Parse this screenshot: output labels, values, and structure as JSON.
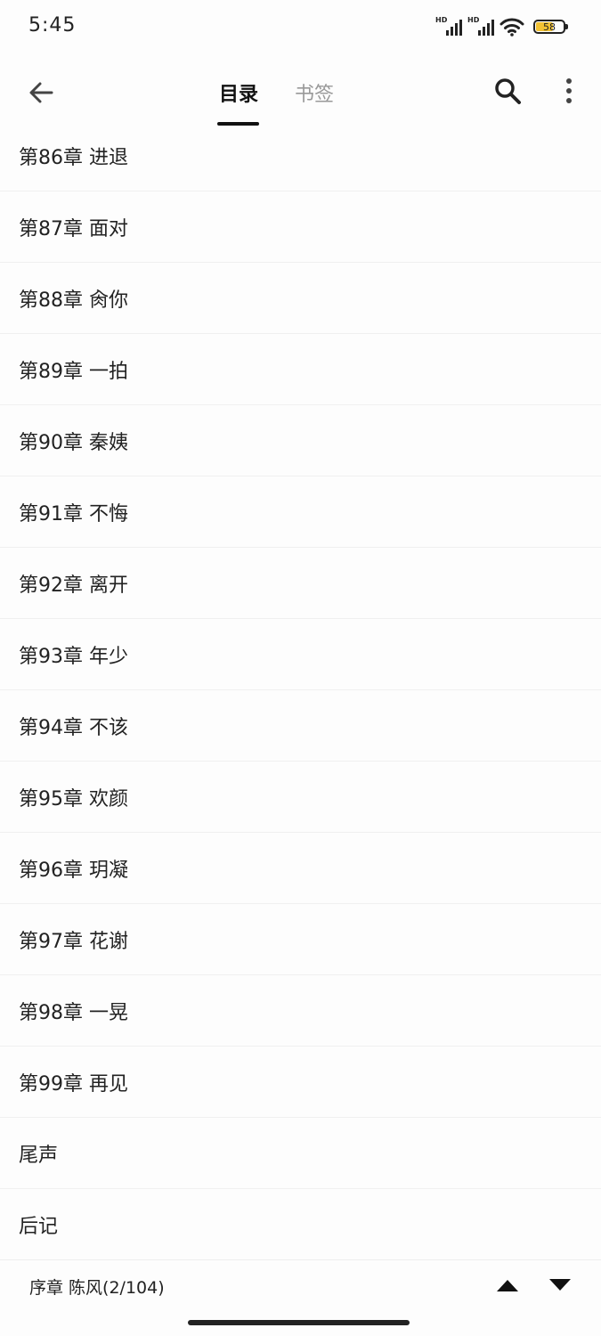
{
  "status_bar": {
    "time": "5:45",
    "signal_label_1": "HD",
    "signal_label_2": "HD",
    "battery_level": "58"
  },
  "header": {
    "tabs": [
      {
        "label": "目录",
        "active": true
      },
      {
        "label": "书签",
        "active": false
      }
    ],
    "icons": {
      "back": "arrow-left-icon",
      "search": "search-icon",
      "more": "more-vertical-icon"
    }
  },
  "chapters": [
    "第86章 进退",
    "第87章 面对",
    "第88章 肏你",
    "第89章 一拍",
    "第90章 秦姨",
    "第91章 不悔",
    "第92章 离开",
    "第93章 年少",
    "第94章 不该",
    "第95章 欢颜",
    "第96章 玥凝",
    "第97章 花谢",
    "第98章 一晃",
    "第99章 再见",
    "尾声",
    "后记"
  ],
  "footer": {
    "current_position": "序章 陈风(2/104)",
    "icons": {
      "prev": "triangle-up-icon",
      "next": "triangle-down-icon"
    }
  },
  "colors": {
    "accent": "#111111",
    "inactive_tab": "#999999",
    "battery_fill": "#f2c233"
  }
}
